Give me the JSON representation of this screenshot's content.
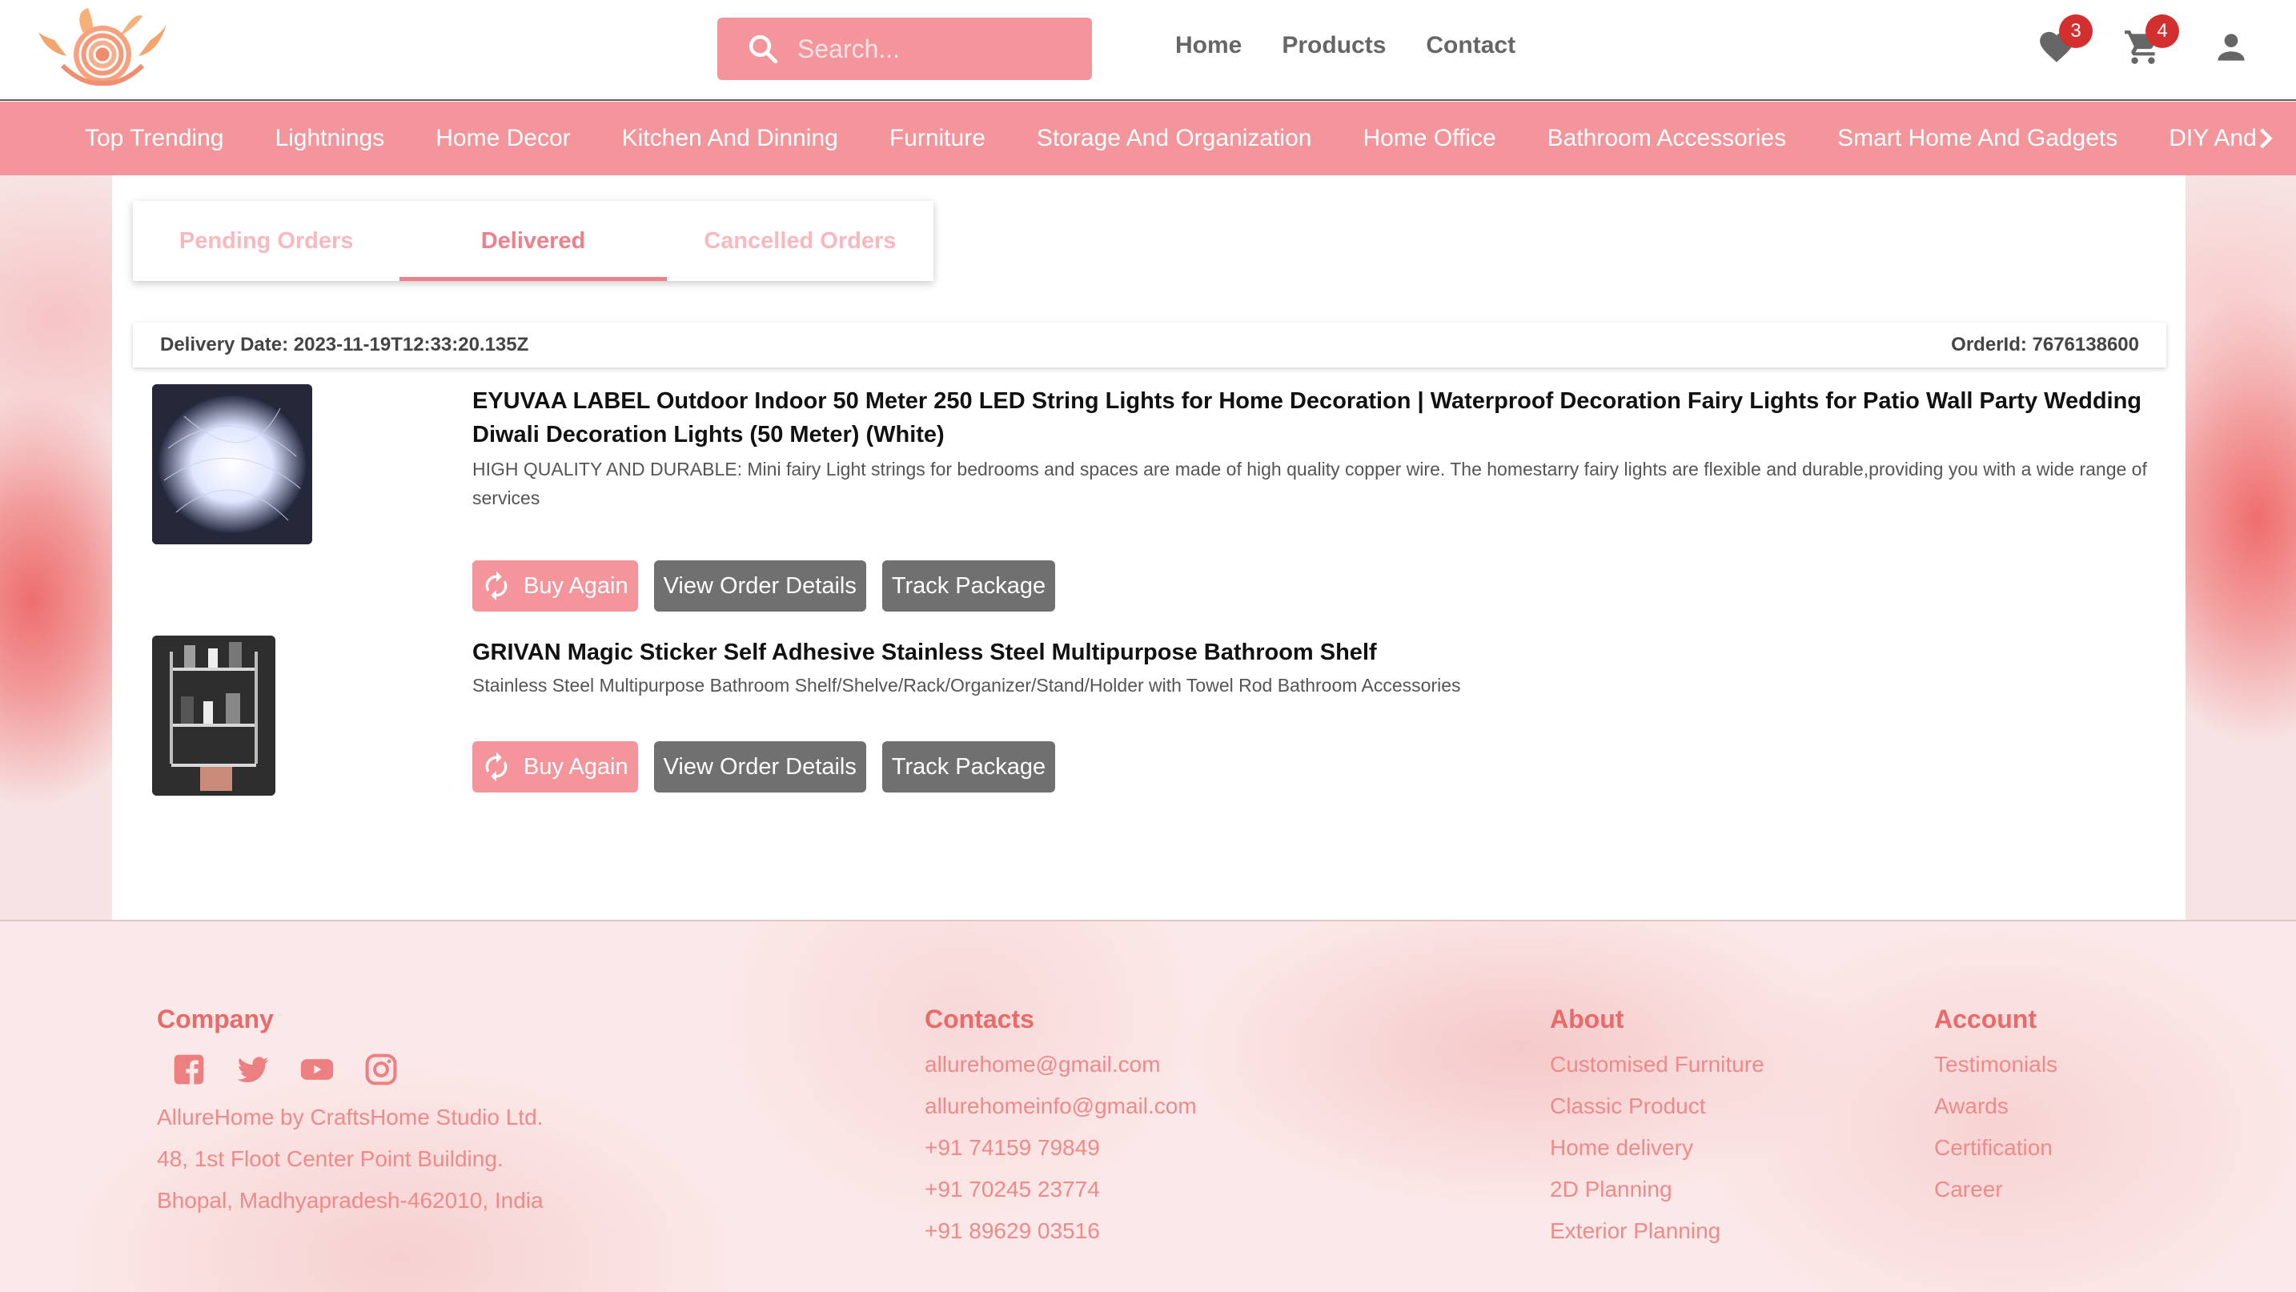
{
  "header": {
    "search_placeholder": "Search...",
    "nav": [
      "Home",
      "Products",
      "Contact"
    ],
    "wishlist_count": "3",
    "cart_count": "4",
    "icons": [
      "logo-flower-icon",
      "search-icon",
      "heart-icon",
      "cart-icon",
      "user-icon"
    ]
  },
  "categories": [
    "Top Trending",
    "Lightnings",
    "Home Decor",
    "Kitchen And Dinning",
    "Furniture",
    "Storage And Organization",
    "Home Office",
    "Bathroom Accessories",
    "Smart Home And Gadgets",
    "DIY And"
  ],
  "tabs": [
    {
      "label": "Pending Orders",
      "active": false
    },
    {
      "label": "Delivered",
      "active": true
    },
    {
      "label": "Cancelled Orders",
      "active": false
    }
  ],
  "order": {
    "delivery_date": "Delivery Date: 2023-11-19T12:33:20.135Z",
    "order_id": "OrderId: 7676138600",
    "items": [
      {
        "title": "EYUVAA LABEL Outdoor Indoor 50 Meter 250 LED String Lights for Home Decoration | Waterproof Decoration Fairy Lights for Patio Wall Party Wedding Diwali Decoration Lights (50 Meter) (White)",
        "description": "HIGH QUALITY AND DURABLE: Mini fairy Light strings for bedrooms and spaces are made of high quality copper wire. The homestarry fairy lights are flexible and durable,providing you with a wide range of services"
      },
      {
        "title": "GRIVAN Magic Sticker Self Adhesive Stainless Steel Multipurpose Bathroom Shelf",
        "description": "Stainless Steel Multipurpose Bathroom Shelf/Shelve/Rack/Organizer/Stand/Holder with Towel Rod Bathroom Accessories"
      }
    ],
    "buttons": {
      "buy_again": "Buy Again",
      "view_details": "View Order Details",
      "track": "Track Package"
    }
  },
  "footer": {
    "company": {
      "heading": "Company",
      "lines": [
        "AllureHome by CraftsHome Studio Ltd.",
        "48, 1st Floot Center Point Building.",
        "Bhopal, Madhyapradesh-462010, India"
      ],
      "social_icons": [
        "facebook-icon",
        "twitter-icon",
        "youtube-icon",
        "instagram-icon"
      ]
    },
    "contacts": {
      "heading": "Contacts",
      "lines": [
        "allurehome@gmail.com",
        "allurehomeinfo@gmail.com",
        "+91 74159 79849",
        "+91 70245 23774",
        "+91 89629 03516"
      ]
    },
    "about": {
      "heading": "About",
      "lines": [
        "Customised Furniture",
        "Classic Product",
        "Home delivery",
        "2D Planning",
        "Exterior Planning"
      ]
    },
    "account": {
      "heading": "Account",
      "lines": [
        "Testimonials",
        "Awards",
        "Certification",
        "Career"
      ]
    }
  },
  "colors": {
    "brand_pink": "#f4959b",
    "active_tab": "#ef7f8a",
    "button_grey": "#707070",
    "footer_text": "#ea6a6a"
  }
}
